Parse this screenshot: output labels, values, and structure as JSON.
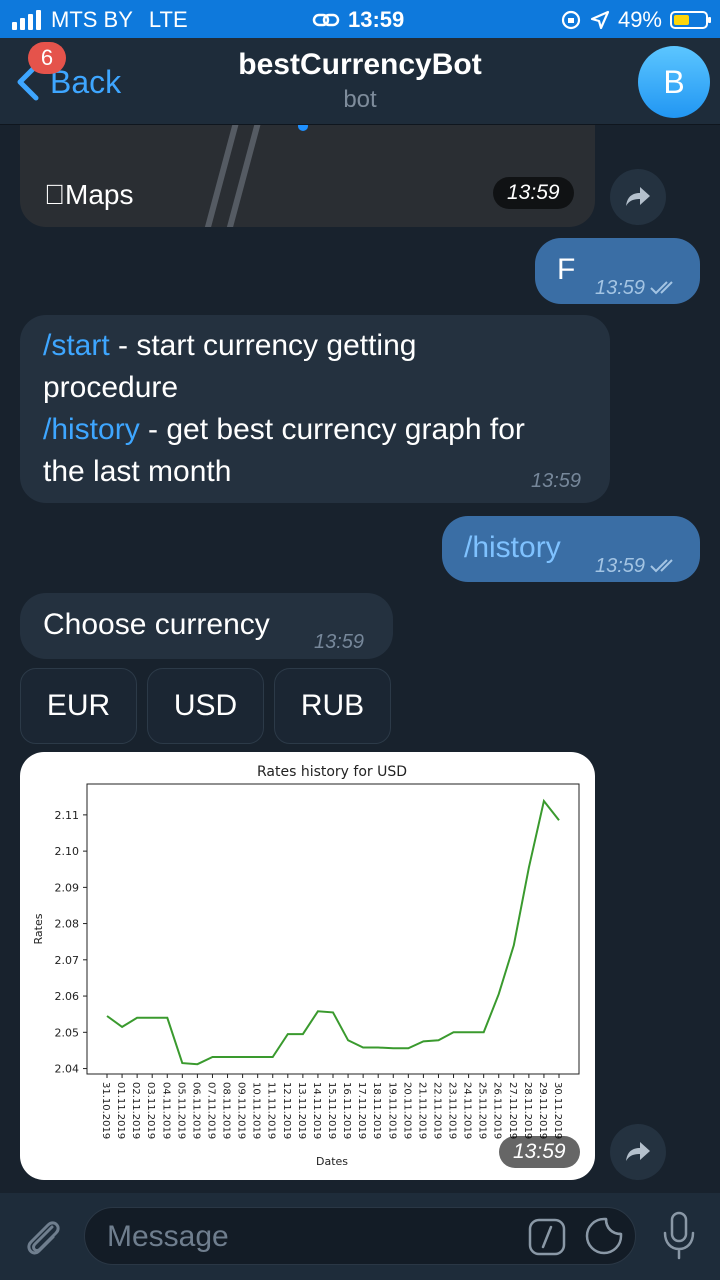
{
  "status_bar": {
    "carrier": "MTS BY",
    "network": "LTE",
    "time": "13:59",
    "battery": "49%",
    "battery_level": 0.49
  },
  "header": {
    "back_label": "Back",
    "unread_badge": "6",
    "title": "bestCurrencyBot",
    "subtitle": "bot",
    "avatar_letter": "B"
  },
  "messages": {
    "maps_label": "Maps",
    "maps_time": "13:59",
    "out_f": {
      "text": "F",
      "time": "13:59"
    },
    "help": {
      "cmd_start": "/start",
      "start_desc_1": " - start currency getting",
      "start_desc_2": "procedure",
      "cmd_history": "/history",
      "history_desc_1": " - get best currency graph for",
      "history_desc_2": "the last month",
      "time": "13:59"
    },
    "out_history": {
      "text": "/history",
      "time": "13:59"
    },
    "choose": {
      "text": "Choose currency",
      "time": "13:59"
    },
    "keyboard": [
      "EUR",
      "USD",
      "RUB"
    ],
    "chart_time": "13:59"
  },
  "chart_data": {
    "type": "line",
    "title": "Rates history for USD",
    "xlabel": "Dates",
    "ylabel": "Rates",
    "x": [
      "31.10.2019",
      "01.11.2019",
      "02.11.2019",
      "03.11.2019",
      "04.11.2019",
      "05.11.2019",
      "06.11.2019",
      "07.11.2019",
      "08.11.2019",
      "09.11.2019",
      "10.11.2019",
      "11.11.2019",
      "12.11.2019",
      "13.11.2019",
      "14.11.2019",
      "15.11.2019",
      "16.11.2019",
      "17.11.2019",
      "18.11.2019",
      "19.11.2019",
      "20.11.2019",
      "21.11.2019",
      "22.11.2019",
      "23.11.2019",
      "24.11.2019",
      "25.11.2019",
      "26.11.2019",
      "27.11.2019",
      "28.11.2019",
      "29.11.2019",
      "30.11.2019"
    ],
    "series": [
      {
        "values": [
          2.0545,
          2.0515,
          2.054,
          2.054,
          2.054,
          2.0415,
          2.0412,
          2.0432,
          2.0432,
          2.0432,
          2.0432,
          2.0432,
          2.0495,
          2.0495,
          2.0558,
          2.0555,
          2.0478,
          2.0458,
          2.0458,
          2.0456,
          2.0456,
          2.0475,
          2.0478,
          2.05,
          2.05,
          2.05,
          2.0605,
          2.074,
          2.0955,
          2.1138,
          2.1085
        ]
      }
    ],
    "ylim": [
      2.0385,
      2.1185
    ],
    "yticks": [
      2.04,
      2.05,
      2.06,
      2.07,
      2.08,
      2.09,
      2.1,
      2.11
    ],
    "ytick_labels": [
      "2.04",
      "2.05",
      "2.06",
      "2.07",
      "2.08",
      "2.09",
      "2.10",
      "2.11"
    ],
    "line_color": "#3a9a2e",
    "grid": false
  },
  "input": {
    "placeholder": "Message"
  },
  "colors": {
    "accent": "#3ea6ff",
    "status_bar": "#0e79dc",
    "outgoing_bubble": "#3a6ea5",
    "incoming_bubble": "#24313f",
    "background": "#18222d"
  }
}
